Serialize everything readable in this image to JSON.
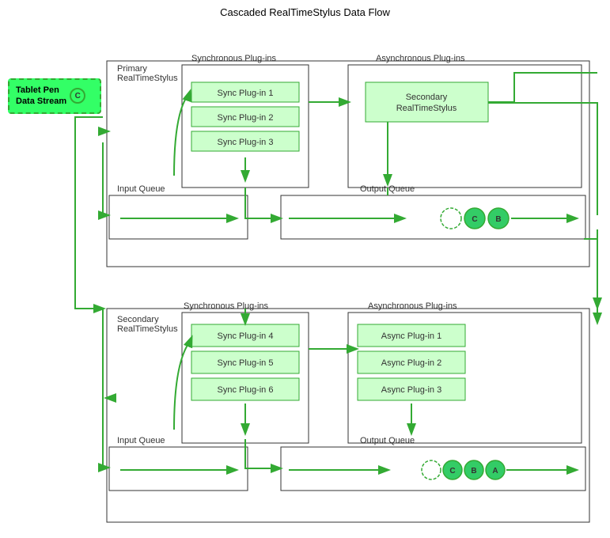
{
  "title": "Cascaded RealTimeStylus Data Flow",
  "tablet_pen": {
    "label": "Tablet Pen\nData Stream",
    "badge": "C"
  },
  "top": {
    "primary_label": "Primary\nRealTimeStylus",
    "sync_label": "Synchronous Plug-ins",
    "async_label": "Asynchronous Plug-ins",
    "input_queue_label": "Input Queue",
    "output_queue_label": "Output Queue",
    "sync_plugins": [
      "Sync Plug-in 1",
      "Sync Plug-in 2",
      "Sync Plug-in 3"
    ],
    "secondary_rts_label": "Secondary\nRealTimeStylus",
    "output_circles": [
      {
        "type": "dashed",
        "label": ""
      },
      {
        "type": "filled",
        "label": "C"
      },
      {
        "type": "filled",
        "label": "B"
      }
    ]
  },
  "bottom": {
    "secondary_label": "Secondary\nRealTimeStylus",
    "sync_label": "Synchronous Plug-ins",
    "async_label": "Asynchronous Plug-ins",
    "input_queue_label": "Input Queue",
    "output_queue_label": "Output Queue",
    "sync_plugins": [
      "Sync Plug-in 4",
      "Sync Plug-in 5",
      "Sync Plug-in 6"
    ],
    "async_plugins": [
      "Async Plug-in 1",
      "Async Plug-in 2",
      "Async Plug-in 3"
    ],
    "output_circles": [
      {
        "type": "dashed",
        "label": ""
      },
      {
        "type": "filled",
        "label": "C"
      },
      {
        "type": "filled",
        "label": "B"
      },
      {
        "type": "filled",
        "label": "A"
      }
    ]
  }
}
